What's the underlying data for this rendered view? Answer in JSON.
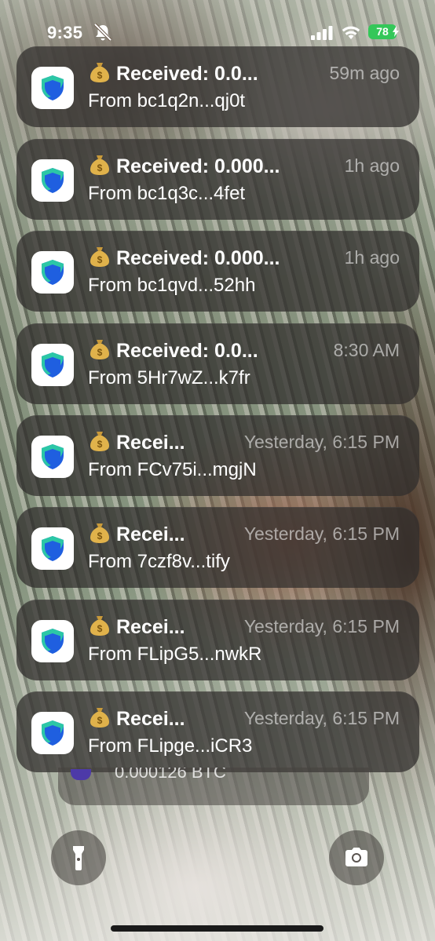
{
  "status_bar": {
    "time": "9:35",
    "battery": "78",
    "icons": [
      "bell-slash-icon",
      "cellular-signal-icon",
      "wifi-icon",
      "battery-charging-icon"
    ],
    "battery_color": "#34c759"
  },
  "notifications": [
    {
      "app_icon": "shield-icon",
      "emoji": "money-bag-icon",
      "title": "Received: 0.0...",
      "time": "59m ago",
      "body": "From bc1q2n...qj0t"
    },
    {
      "app_icon": "shield-icon",
      "emoji": "money-bag-icon",
      "title": "Received: 0.000...",
      "time": "1h ago",
      "body": "From bc1q3c...4fet"
    },
    {
      "app_icon": "shield-icon",
      "emoji": "money-bag-icon",
      "title": "Received: 0.000...",
      "time": "1h ago",
      "body": "From bc1qvd...52hh"
    },
    {
      "app_icon": "shield-icon",
      "emoji": "money-bag-icon",
      "title": "Received: 0.0...",
      "time": "8:30 AM",
      "body": "From 5Hr7wZ...k7fr"
    },
    {
      "app_icon": "shield-icon",
      "emoji": "money-bag-icon",
      "title": "Recei...",
      "time": "Yesterday, 6:15 PM",
      "body": "From FCv75i...mgjN"
    },
    {
      "app_icon": "shield-icon",
      "emoji": "money-bag-icon",
      "title": "Recei...",
      "time": "Yesterday, 6:15 PM",
      "body": "From 7czf8v...tify"
    },
    {
      "app_icon": "shield-icon",
      "emoji": "money-bag-icon",
      "title": "Recei...",
      "time": "Yesterday, 6:15 PM",
      "body": "From FLipG5...nwkR"
    },
    {
      "app_icon": "shield-icon",
      "emoji": "money-bag-icon",
      "title": "Recei...",
      "time": "Yesterday, 6:15 PM",
      "body": "From FLipge...iCR3"
    }
  ],
  "stacked_peek": {
    "text": "0.000126 BTC"
  },
  "controls": {
    "left": "flashlight-icon",
    "right": "camera-icon"
  },
  "colors": {
    "shield_blue": "#1f5fe0",
    "shield_green": "#2ed3a0"
  }
}
